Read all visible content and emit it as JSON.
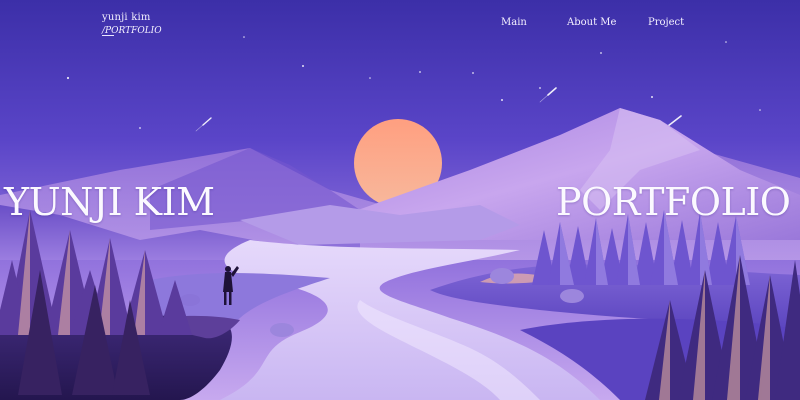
{
  "header": {
    "logo_name": "yunji kim",
    "logo_sub": "/PORTFOLIO"
  },
  "nav": {
    "items": [
      {
        "label": "Main"
      },
      {
        "label": "About Me"
      },
      {
        "label": "Project"
      }
    ]
  },
  "hero": {
    "left_title": "YUNJI KIM",
    "right_title": "PORTFOLIO"
  },
  "colors": {
    "sky_top": "#3c2fa8",
    "sky_bottom": "#b18ce6",
    "sun": "#f59a86",
    "text": "#f4f1ff"
  }
}
